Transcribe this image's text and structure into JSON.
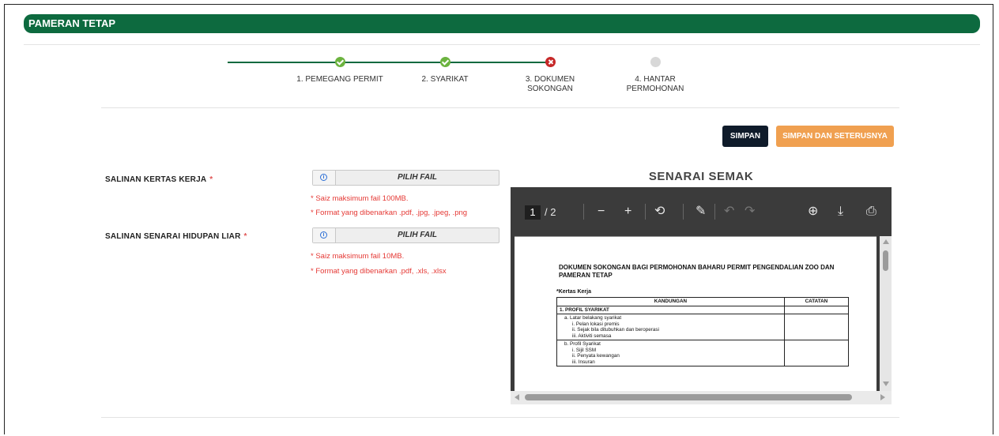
{
  "header": {
    "title": "PAMERAN TETAP"
  },
  "stepper": {
    "steps": [
      {
        "label": "1. PEMEGANG PERMIT",
        "status": "done"
      },
      {
        "label": "2. SYARIKAT",
        "status": "done"
      },
      {
        "label": "3. DOKUMEN SOKONGAN",
        "status": "error"
      },
      {
        "label": "4. HANTAR PERMOHONAN",
        "status": "pending"
      }
    ],
    "colors": {
      "line": "#0d6a3f",
      "done": "#6cb33f",
      "error": "#c62828",
      "pending": "#d8d8d8"
    }
  },
  "actions": {
    "save_label": "SIMPAN",
    "save_next_label": "SIMPAN DAN SETERUSNYA"
  },
  "form": {
    "fields": [
      {
        "label": "SALINAN KERTAS KERJA",
        "required_mark": "*",
        "button": "PILIH FAIL",
        "info_icon": "i",
        "hints": [
          "* Saiz maksimum fail 100MB.",
          "* Format yang dibenarkan .pdf, .jpg, .jpeg, .png"
        ]
      },
      {
        "label": "SALINAN SENARAI HIDUPAN LIAR",
        "required_mark": "*",
        "button": "PILIH FAIL",
        "info_icon": "i",
        "hints": [
          "* Saiz maksimum fail 10MB.",
          "* Format yang dibenarkan .pdf, .xls, .xlsx"
        ]
      }
    ]
  },
  "checklist": {
    "title": "SENARAI SEMAK",
    "viewer": {
      "current_page": "1",
      "total_pages": "/ 2",
      "icons": {
        "zoom_out": "−",
        "zoom_in": "+",
        "rotate": "⟲",
        "draw": "✎",
        "undo": "↶",
        "redo": "↷",
        "add_text": "⊕",
        "download": "⤓",
        "print": "⎙"
      }
    },
    "document": {
      "title": "DOKUMEN SOKONGAN BAGI PERMOHONAN BAHARU PERMIT PENGENDALIAN ZOO DAN PAMERAN TETAP",
      "subtitle": "*Kertas Kerja",
      "table": {
        "headers": [
          "KANDUNGAN",
          "CATATAN"
        ],
        "section": "1. PROFIL SYARIKAT",
        "group_a": {
          "title": "a.  Latar belakang syarikat",
          "items": [
            "i.  Pelan lokasi premis",
            "ii. Sejak bila ditubuhkan dan beroperasi",
            "iii. Aktiviti semasa"
          ]
        },
        "group_b": {
          "title": "b. Profil Syarikat",
          "items": [
            "i.  Sijil SSM",
            "ii.  Penyata kewangan",
            "iii. Insuran"
          ]
        }
      }
    }
  }
}
